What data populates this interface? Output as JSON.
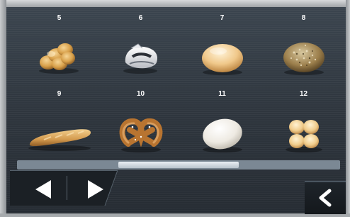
{
  "products": [
    {
      "number": "5",
      "item": "braided-roll-icon"
    },
    {
      "number": "6",
      "item": "wrapped-pastry-icon"
    },
    {
      "number": "7",
      "item": "bread-roll-icon"
    },
    {
      "number": "8",
      "item": "seeded-roll-icon"
    },
    {
      "number": "9",
      "item": "baguette-icon"
    },
    {
      "number": "10",
      "item": "pretzel-icon"
    },
    {
      "number": "11",
      "item": "white-roll-icon"
    },
    {
      "number": "12",
      "item": "four-part-roll-icon"
    }
  ],
  "scrollbar": {
    "position": 0.5
  },
  "navigation": {
    "prev_icon": "left-arrow-icon",
    "next_icon": "right-arrow-icon"
  },
  "back_icon": "back-chevron-icon",
  "colors": {
    "background": "#2e353d",
    "accent": "#ffffff",
    "crust": "#d39a52"
  }
}
